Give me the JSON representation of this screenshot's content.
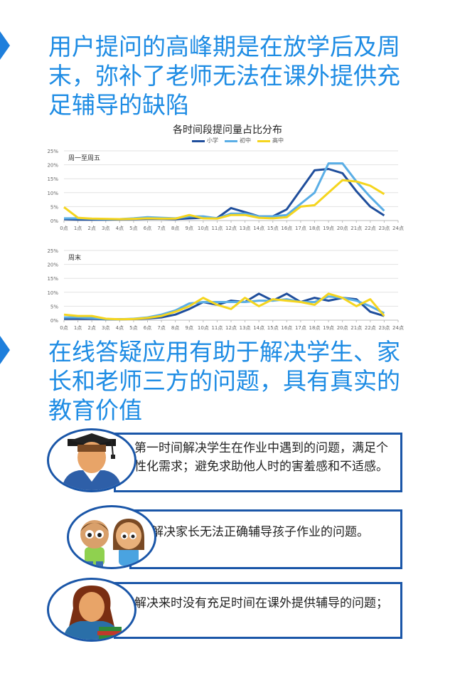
{
  "heading1": "用户提问的高峰期是在放学后及周末，弥补了老师无法在课外提供充足辅导的缺陷",
  "heading2": "在线答疑应用有助于解决学生、家长和老师三方的问题，具有真实的教育价值",
  "colors": {
    "accent": "#1e8ce4",
    "marker": "#1e7fdc",
    "card_border": "#1a56a8"
  },
  "chart_data": [
    {
      "type": "line",
      "title": "各时间段提问量占比分布",
      "panel_label": "周一至周五",
      "x": [
        "0点",
        "1点",
        "2点",
        "3点",
        "4点",
        "5点",
        "6点",
        "7点",
        "8点",
        "9点",
        "10点",
        "11点",
        "12点",
        "13点",
        "14点",
        "15点",
        "16点",
        "17点",
        "18点",
        "19点",
        "20点",
        "21点",
        "22点",
        "23点",
        "24点"
      ],
      "ylim": [
        0,
        25
      ],
      "yticks": [
        "0%",
        "5%",
        "10%",
        "15%",
        "20%",
        "25%"
      ],
      "grid": true,
      "legend_position": "top-center",
      "series": [
        {
          "name": "小学",
          "color": "#1f4e9c",
          "values": [
            0.5,
            0.3,
            0.3,
            0.3,
            0.4,
            0.5,
            0.6,
            0.6,
            0.5,
            0.8,
            1.0,
            0.9,
            4.5,
            3.0,
            1.5,
            1.5,
            4.0,
            11.0,
            18.0,
            18.5,
            17.0,
            10.5,
            5.0,
            1.8
          ]
        },
        {
          "name": "初中",
          "color": "#5aaee6",
          "values": [
            0.8,
            0.8,
            0.6,
            0.5,
            0.5,
            0.8,
            1.2,
            1.0,
            0.8,
            1.5,
            1.5,
            0.8,
            2.5,
            2.5,
            1.5,
            1.5,
            2.0,
            6.0,
            10.0,
            20.5,
            20.5,
            14.0,
            8.5,
            3.5
          ]
        },
        {
          "name": "高中",
          "color": "#f5d51e",
          "values": [
            4.8,
            1.0,
            0.7,
            0.6,
            0.5,
            0.6,
            0.8,
            0.7,
            0.7,
            2.0,
            0.8,
            0.7,
            2.0,
            2.0,
            1.0,
            0.8,
            1.2,
            5.0,
            5.5,
            10.0,
            14.5,
            14.0,
            12.5,
            9.5
          ]
        }
      ]
    },
    {
      "type": "line",
      "panel_label": "周末",
      "x": [
        "0点",
        "1点",
        "2点",
        "3点",
        "4点",
        "5点",
        "6点",
        "7点",
        "8点",
        "9点",
        "10点",
        "11点",
        "12点",
        "13点",
        "14点",
        "15点",
        "16点",
        "17点",
        "18点",
        "19点",
        "20点",
        "21点",
        "22点",
        "23点",
        "24点"
      ],
      "ylim": [
        0,
        25
      ],
      "yticks": [
        "0%",
        "5%",
        "10%",
        "15%",
        "20%",
        "25%"
      ],
      "grid": true,
      "series": [
        {
          "name": "小学",
          "color": "#1f4e9c",
          "values": [
            0.5,
            0.5,
            0.5,
            0.3,
            0.3,
            0.4,
            0.6,
            1.0,
            2.0,
            4.0,
            6.5,
            5.5,
            7.0,
            6.5,
            9.5,
            7.0,
            9.5,
            6.5,
            8.0,
            7.0,
            8.0,
            7.5,
            3.0,
            1.5
          ]
        },
        {
          "name": "初中",
          "color": "#5aaee6",
          "values": [
            1.0,
            1.0,
            0.8,
            0.4,
            0.3,
            0.5,
            1.0,
            2.0,
            3.5,
            6.0,
            6.5,
            6.5,
            6.5,
            6.5,
            7.0,
            7.0,
            7.5,
            6.5,
            6.5,
            8.5,
            8.0,
            7.0,
            5.0,
            2.5
          ]
        },
        {
          "name": "高中",
          "color": "#f5d51e",
          "values": [
            2.0,
            1.5,
            1.5,
            0.5,
            0.3,
            0.4,
            0.8,
            1.5,
            3.0,
            5.0,
            8.0,
            5.5,
            4.0,
            8.0,
            5.0,
            7.5,
            7.0,
            6.5,
            5.5,
            9.5,
            8.0,
            5.0,
            7.5,
            1.5
          ]
        }
      ]
    }
  ],
  "cards": [
    {
      "avatar": "graduate-student-icon",
      "text": "第一时间解决学生在作业中遇到的问题，满足个性化需求；避免求助他人时的害羞感和不适感。"
    },
    {
      "avatar": "parents-icon",
      "text": "解决家长无法正确辅导孩子作业的问题。"
    },
    {
      "avatar": "teacher-icon",
      "text": "解决来时没有充足时间在课外提供辅导的问题；"
    }
  ]
}
